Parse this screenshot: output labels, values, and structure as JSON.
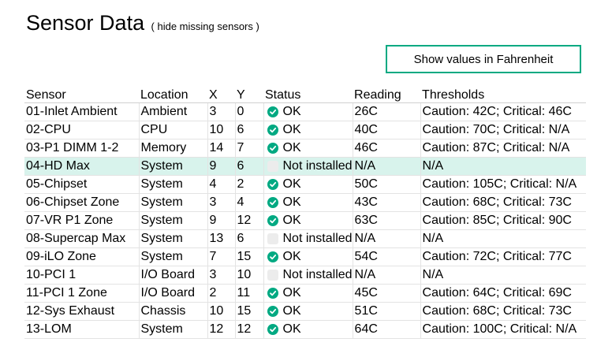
{
  "page": {
    "title": "Sensor Data",
    "hide_link": "( hide missing sensors )",
    "fahrenheit_button": "Show values in Fahrenheit"
  },
  "colors": {
    "accent": "#01a982",
    "highlight_row": "#d8f3ec"
  },
  "table": {
    "headers": {
      "sensor": "Sensor",
      "location": "Location",
      "x": "X",
      "y": "Y",
      "status": "Status",
      "reading": "Reading",
      "thresholds": "Thresholds"
    },
    "rows": [
      {
        "sensor": "01-Inlet Ambient",
        "location": "Ambient",
        "x": "3",
        "y": "0",
        "status": "OK",
        "status_icon": "check-circle-icon",
        "reading": "26C",
        "thresholds": "Caution: 42C; Critical: 46C",
        "highlighted": false
      },
      {
        "sensor": "02-CPU",
        "location": "CPU",
        "x": "10",
        "y": "6",
        "status": "OK",
        "status_icon": "check-circle-icon",
        "reading": "40C",
        "thresholds": "Caution: 70C; Critical: N/A",
        "highlighted": false
      },
      {
        "sensor": "03-P1 DIMM 1-2",
        "location": "Memory",
        "x": "14",
        "y": "7",
        "status": "OK",
        "status_icon": "check-circle-icon",
        "reading": "46C",
        "thresholds": "Caution: 87C; Critical: N/A",
        "highlighted": false
      },
      {
        "sensor": "04-HD Max",
        "location": "System",
        "x": "9",
        "y": "6",
        "status": "Not installed",
        "status_icon": "not-installed-icon",
        "reading": "N/A",
        "thresholds": "N/A",
        "highlighted": true
      },
      {
        "sensor": "05-Chipset",
        "location": "System",
        "x": "4",
        "y": "2",
        "status": "OK",
        "status_icon": "check-circle-icon",
        "reading": "50C",
        "thresholds": "Caution: 105C; Critical: N/A",
        "highlighted": false
      },
      {
        "sensor": "06-Chipset Zone",
        "location": "System",
        "x": "3",
        "y": "4",
        "status": "OK",
        "status_icon": "check-circle-icon",
        "reading": "43C",
        "thresholds": "Caution: 68C; Critical: 73C",
        "highlighted": false
      },
      {
        "sensor": "07-VR P1 Zone",
        "location": "System",
        "x": "9",
        "y": "12",
        "status": "OK",
        "status_icon": "check-circle-icon",
        "reading": "63C",
        "thresholds": "Caution: 85C; Critical: 90C",
        "highlighted": false
      },
      {
        "sensor": "08-Supercap Max",
        "location": "System",
        "x": "13",
        "y": "6",
        "status": "Not installed",
        "status_icon": "not-installed-icon",
        "reading": "N/A",
        "thresholds": "N/A",
        "highlighted": false
      },
      {
        "sensor": "09-iLO Zone",
        "location": "System",
        "x": "7",
        "y": "15",
        "status": "OK",
        "status_icon": "check-circle-icon",
        "reading": "54C",
        "thresholds": "Caution: 72C; Critical: 77C",
        "highlighted": false
      },
      {
        "sensor": "10-PCI 1",
        "location": "I/O Board",
        "x": "3",
        "y": "10",
        "status": "Not installed",
        "status_icon": "not-installed-icon",
        "reading": "N/A",
        "thresholds": "N/A",
        "highlighted": false
      },
      {
        "sensor": "11-PCI 1 Zone",
        "location": "I/O Board",
        "x": "2",
        "y": "11",
        "status": "OK",
        "status_icon": "check-circle-icon",
        "reading": "45C",
        "thresholds": "Caution: 64C; Critical: 69C",
        "highlighted": false
      },
      {
        "sensor": "12-Sys Exhaust",
        "location": "Chassis",
        "x": "10",
        "y": "15",
        "status": "OK",
        "status_icon": "check-circle-icon",
        "reading": "51C",
        "thresholds": "Caution: 68C; Critical: 73C",
        "highlighted": false
      },
      {
        "sensor": "13-LOM",
        "location": "System",
        "x": "12",
        "y": "12",
        "status": "OK",
        "status_icon": "check-circle-icon",
        "reading": "64C",
        "thresholds": "Caution: 100C; Critical: N/A",
        "highlighted": false
      }
    ]
  }
}
